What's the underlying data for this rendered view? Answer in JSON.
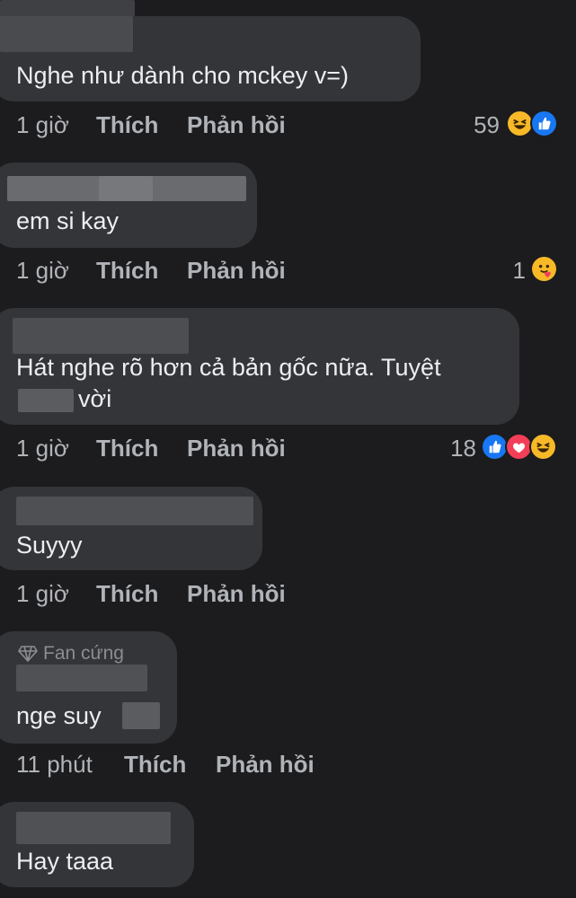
{
  "comments": [
    {
      "text": "Nghe như dành cho mckey v=)",
      "time": "1 giờ",
      "like": "Thích",
      "reply": "Phản hồi",
      "reactions_count": "59",
      "reactions": [
        "haha",
        "like"
      ]
    },
    {
      "text": "em si kay",
      "time": "1 giờ",
      "like": "Thích",
      "reply": "Phản hồi",
      "reactions_count": "1",
      "reactions": [
        "care"
      ]
    },
    {
      "text_line1": "Hát nghe rõ hơn cả bản gốc nữa. Tuyệt",
      "text_line2": "vời",
      "time": "1 giờ",
      "like": "Thích",
      "reply": "Phản hồi",
      "reactions_count": "18",
      "reactions": [
        "like",
        "love",
        "haha"
      ]
    },
    {
      "text": "Suyyy",
      "time": "1 giờ",
      "like": "Thích",
      "reply": "Phản hồi"
    },
    {
      "badge": "Fan cứng",
      "text": "nge suy",
      "time": "11 phút",
      "like": "Thích",
      "reply": "Phản hồi"
    },
    {
      "text": "Hay taaa"
    }
  ],
  "colors": {
    "background": "#1c1c1e",
    "bubble": "#343538",
    "like_blue": "#1877f2",
    "love_red": "#f33e58",
    "haha_yellow": "#f7b928"
  }
}
